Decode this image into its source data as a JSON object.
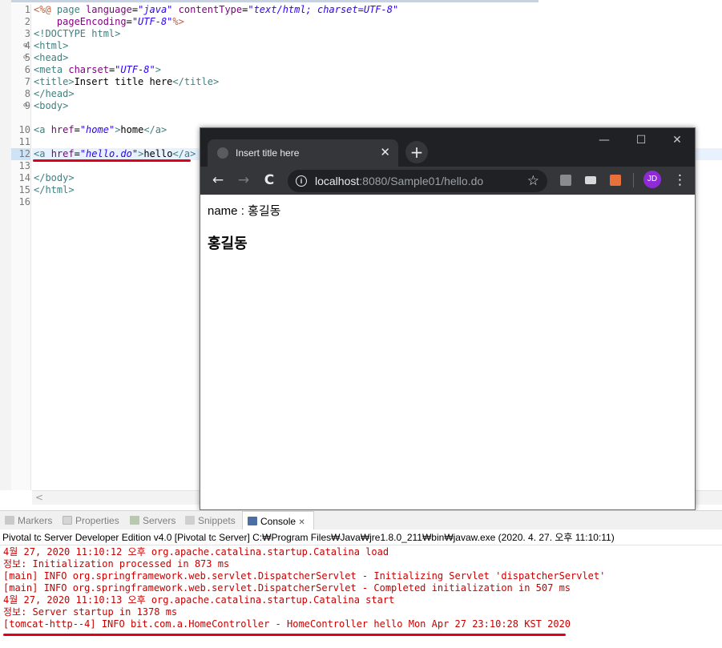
{
  "editor": {
    "line_numbers": [
      "1",
      "2",
      "3",
      "4",
      "5",
      "6",
      "7",
      "8",
      "9",
      "10",
      "11",
      "12",
      "13",
      "14",
      "15",
      "16"
    ],
    "lines": {
      "l1": {
        "a": "<%@ ",
        "b": "page ",
        "c": "language",
        "d": "=",
        "e": "\"java\"",
        "f": " contentType",
        "g": "=",
        "h": "\"text/html; charset=UTF-8\""
      },
      "l2": {
        "a": "    pageEncoding",
        "b": "=",
        "c": "\"UTF-8\"",
        "d": "%>"
      },
      "l3": {
        "a": "<!DOCTYPE html>"
      },
      "l4": {
        "a": "<html>"
      },
      "l5": {
        "a": "<head>"
      },
      "l6": {
        "a": "<meta ",
        "b": "charset",
        "c": "=",
        "d": "\"UTF-8\"",
        "e": ">"
      },
      "l7": {
        "a": "<title>",
        "b": "Insert title here",
        "c": "</title>"
      },
      "l8": {
        "a": "</head>"
      },
      "l9": {
        "a": "<body>"
      },
      "l11": {
        "a": "<a ",
        "b": "href",
        "c": "=",
        "d": "\"home\"",
        "e": ">",
        "f": "home",
        "g": "</a>"
      },
      "l13": {
        "a": "<a ",
        "b": "href",
        "c": "=",
        "d": "\"hello.do\"",
        "e": ">",
        "f": "hello",
        "g": "</a>"
      },
      "l15": {
        "a": "</body>"
      },
      "l16": {
        "a": "</html>"
      }
    },
    "fold_markers": [
      "⊖",
      "⊖",
      "⊖"
    ],
    "scroll_arrow": "<"
  },
  "browser": {
    "tab_title": "Insert title here",
    "tab_close": "✕",
    "new_tab": "+",
    "window_buttons": {
      "minimize": "—",
      "maximize": "☐",
      "close": "✕"
    },
    "nav": {
      "back": "←",
      "forward": "→",
      "reload": "C"
    },
    "url_host": "localhost",
    "url_rest": ":8080/Sample01/hello.do",
    "info_icon": "i",
    "star": "☆",
    "avatar": "JD",
    "menu": "⋮",
    "content": {
      "name_line": "name : 홍길동",
      "heading": "홍길동"
    },
    "colors": {
      "titlebar": "#202124",
      "toolbar": "#35363a",
      "avatar": "#8e2bd6"
    }
  },
  "panel": {
    "tabs": [
      "Markers",
      "Properties",
      "Servers",
      "Snippets",
      "Console"
    ],
    "console_close": "✕",
    "server_line": "Pivotal tc Server Developer Edition v4.0 [Pivotal tc Server] C:₩Program Files₩Java₩jre1.8.0_211₩bin₩javaw.exe (2020. 4. 27. 오후 11:10:11)",
    "console_lines": [
      "4월 27, 2020 11:10:12 오후 org.apache.catalina.startup.Catalina load",
      "정보: Initialization processed in 873 ms",
      "[main] INFO org.springframework.web.servlet.DispatcherServlet - Initializing Servlet 'dispatcherServlet'",
      "[main] INFO org.springframework.web.servlet.DispatcherServlet - Completed initialization in 507 ms",
      "4월 27, 2020 11:10:13 오후 org.apache.catalina.startup.Catalina start",
      "정보: Server startup in 1378 ms",
      "[tomcat-http--4] INFO bit.com.a.HomeController - HomeController hello Mon Apr 27 23:10:28 KST 2020"
    ],
    "colors": {
      "console_text": "#c80000",
      "annotation_underline": "#e0001b"
    }
  }
}
